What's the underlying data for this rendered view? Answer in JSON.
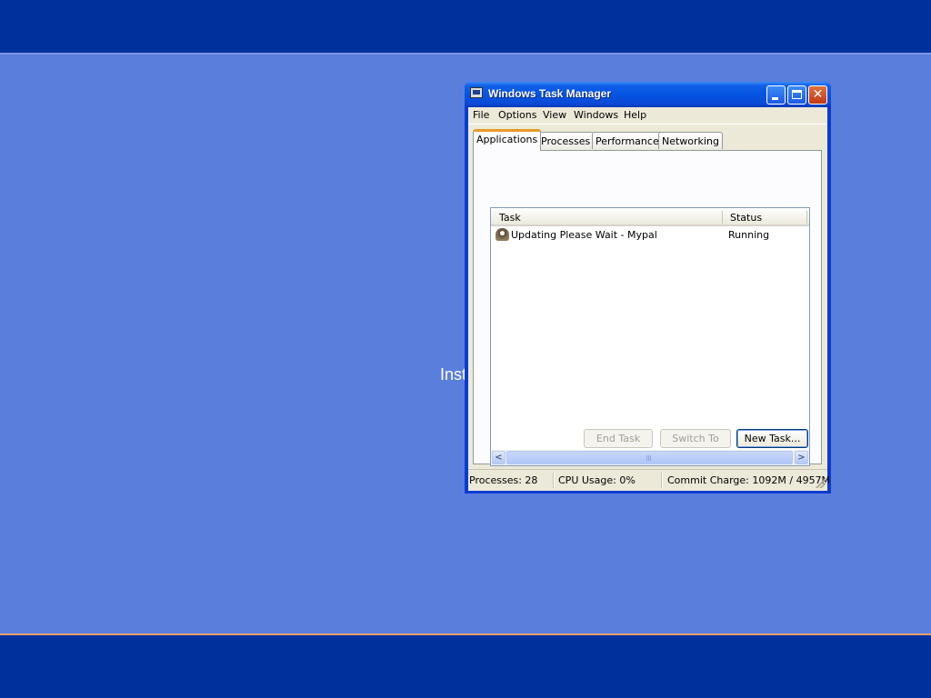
{
  "desktop": {
    "partial_text": "Inst",
    "colors": {
      "background": "#5a7edc",
      "band": "#00309c"
    }
  },
  "window": {
    "title": "Windows Task Manager",
    "icon": "task-manager-icon",
    "controls": {
      "minimize": "minimize-icon",
      "maximize": "maximize-icon",
      "close": "close-icon",
      "close_glyph": "✕"
    }
  },
  "menubar": {
    "items": [
      "File",
      "Options",
      "View",
      "Windows",
      "Help"
    ]
  },
  "tabs": [
    {
      "label": "Applications",
      "active": true
    },
    {
      "label": "Processes",
      "active": false
    },
    {
      "label": "Performance",
      "active": false
    },
    {
      "label": "Networking",
      "active": false
    }
  ],
  "applications": {
    "columns": [
      "Task",
      "Status"
    ],
    "rows": [
      {
        "task": "Updating Please Wait - Mypal",
        "status": "Running",
        "icon": "mypal-app-icon"
      }
    ]
  },
  "scrollbar": {
    "left_glyph": "<",
    "right_glyph": ">"
  },
  "buttons": {
    "end_task": "End Task",
    "switch_to": "Switch To",
    "new_task": "New Task..."
  },
  "statusbar": {
    "processes": "Processes: 28",
    "cpu": "CPU Usage: 0%",
    "commit": "Commit Charge: 1092M / 4957M"
  }
}
